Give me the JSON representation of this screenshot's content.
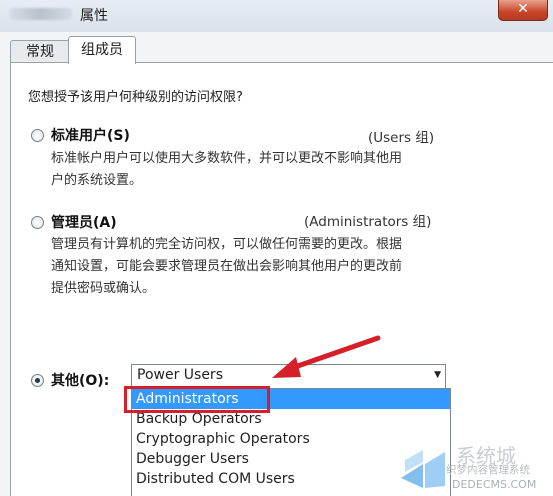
{
  "window": {
    "title": "属性",
    "close_glyph": "✕"
  },
  "tabs": [
    {
      "label": "常规",
      "active": false
    },
    {
      "label": "组成员",
      "active": true
    }
  ],
  "question": "您想授予该用户何种级别的访问权限?",
  "options": [
    {
      "label": "标准用户(S)",
      "group": "(Users 组)",
      "checked": false,
      "description": [
        "标准帐户用户可以使用大多数软件，并可以更改不影响其他用",
        "户的系统设置。"
      ]
    },
    {
      "label": "管理员(A)",
      "group": "(Administrators 组)",
      "checked": false,
      "description": [
        "管理员有计算机的完全访问权，可以做任何需要的更改。根据",
        "通知设置，可能会要求管理员在做出会影响其他用户的更改前",
        "提供密码或确认。"
      ]
    },
    {
      "label": "其他(O):",
      "checked": true
    }
  ],
  "other_select": {
    "value": "Power Users",
    "items": [
      "Administrators",
      "Backup Operators",
      "Cryptographic Operators",
      "Debugger Users",
      "Distributed COM Users"
    ],
    "highlighted": "Administrators"
  },
  "watermark": {
    "line1": "系统城",
    "line2": "织梦内容管理系统",
    "line3": "DEDECMS.COM"
  },
  "colors": {
    "highlight_red": "#d5202a",
    "selection_blue": "#3399ff"
  }
}
